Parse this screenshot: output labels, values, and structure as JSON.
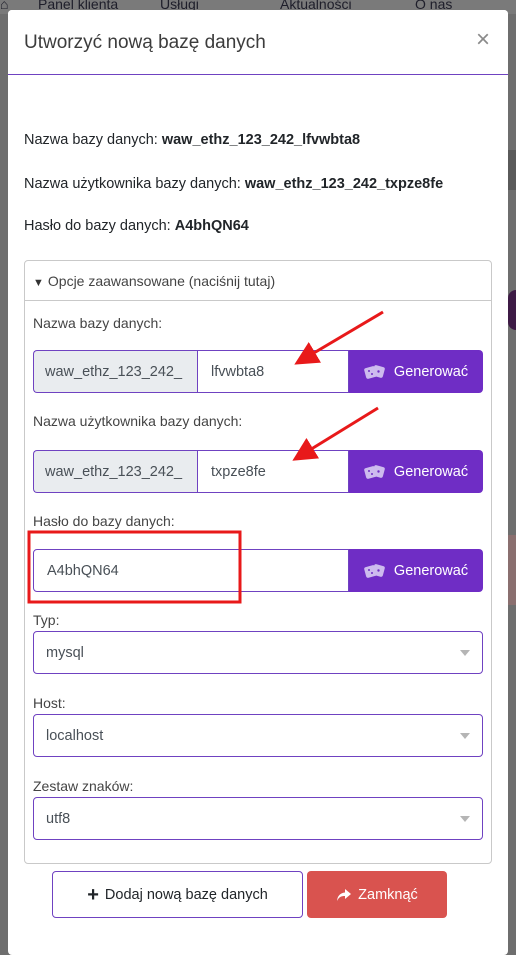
{
  "background_nav": {
    "items": [
      "Panel klienta",
      "Usługi",
      "Aktualności",
      "O nas"
    ]
  },
  "modal": {
    "title": "Utworzyć nową bazę danych",
    "close_symbol": "×",
    "info": [
      {
        "label": "Nazwa bazy danych:",
        "value": "waw_ethz_123_242_lfvwbta8"
      },
      {
        "label": "Nazwa użytkownika bazy danych:",
        "value": "waw_ethz_123_242_txpze8fe"
      },
      {
        "label": "Hasło do bazy danych:",
        "value": "A4bhQN64"
      }
    ],
    "advanced": {
      "toggle_label": "Opcje zaawansowane (naciśnij tutaj)",
      "db_name": {
        "label": "Nazwa bazy danych:",
        "prefix": "waw_ethz_123_242_",
        "value": "lfvwbta8",
        "button": "Generować"
      },
      "db_user": {
        "label": "Nazwa użytkownika bazy danych:",
        "prefix": "waw_ethz_123_242_",
        "value": "txpze8fe",
        "button": "Generować"
      },
      "db_password": {
        "label": "Hasło do bazy danych:",
        "value": "A4bhQN64",
        "button": "Generować"
      },
      "type": {
        "label": "Typ:",
        "value": "mysql"
      },
      "host": {
        "label": "Host:",
        "value": "localhost"
      },
      "charset": {
        "label": "Zestaw znaków:",
        "value": "utf8"
      }
    },
    "footer": {
      "add_label": "Dodaj nową bazę danych",
      "close_label": "Zamknąć"
    }
  },
  "colors": {
    "accent": "#6f2dc5",
    "danger": "#d9534f",
    "annotation": "#e8191a"
  }
}
